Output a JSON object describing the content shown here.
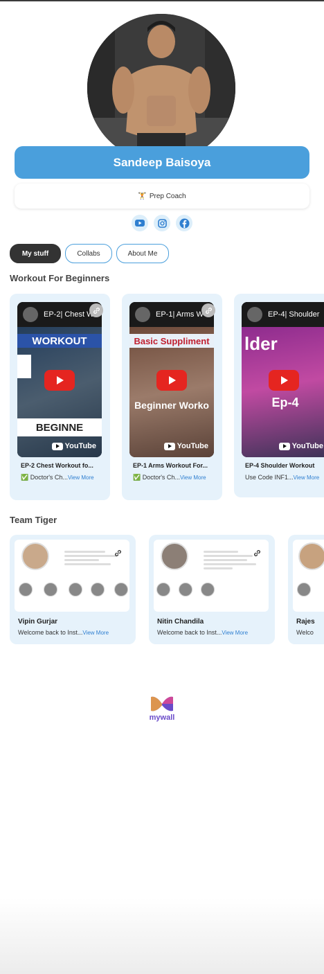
{
  "profile": {
    "name": "Sandeep Baisoya",
    "role": "Prep Coach",
    "role_emoji": "🏋️"
  },
  "socials": [
    {
      "icon": "youtube-icon"
    },
    {
      "icon": "instagram-icon"
    },
    {
      "icon": "facebook-icon"
    }
  ],
  "tabs": [
    {
      "label": "My stuff",
      "active": true
    },
    {
      "label": "Collabs",
      "active": false
    },
    {
      "label": "About Me",
      "active": false
    }
  ],
  "sections": {
    "workout_title": "Workout For Beginners",
    "team_title": "Team Tiger"
  },
  "videos": [
    {
      "head": "EP-2| Chest W",
      "banner": "WORKOUT",
      "lower": "BEGINNE",
      "title": "EP-2 Chest Workout fo...",
      "desc": "✅ Doctor's Ch...",
      "more": "View More",
      "youtube": "YouTube"
    },
    {
      "head": "EP-1| Arms W",
      "banner": "Basic Suppliment",
      "lower": "Beginner Worko",
      "title": "EP-1 Arms Workout For...",
      "desc": "✅ Doctor's Ch...",
      "more": "View More",
      "youtube": "YouTube"
    },
    {
      "head": "EP-4| Shoulder",
      "banner": "lder",
      "lower": "Ep-4",
      "title": "EP-4 Shoulder Workout",
      "desc": "Use Code INF1...",
      "more": "View More",
      "youtube": "YouTube"
    }
  ],
  "team": [
    {
      "name": "Vipin Gurjar",
      "desc": "Welcome back to Inst...",
      "more": "View More"
    },
    {
      "name": "Nitin Chandila",
      "desc": "Welcome back to Inst...",
      "more": "View More"
    },
    {
      "name": "Rajes",
      "desc": "Welco",
      "more": ""
    }
  ],
  "footer": {
    "brand": "mywall"
  },
  "colors": {
    "accent": "#4a9fdc",
    "card_bg": "#e6f2fb",
    "dark_tab": "#333333",
    "youtube_red": "#e52520"
  }
}
